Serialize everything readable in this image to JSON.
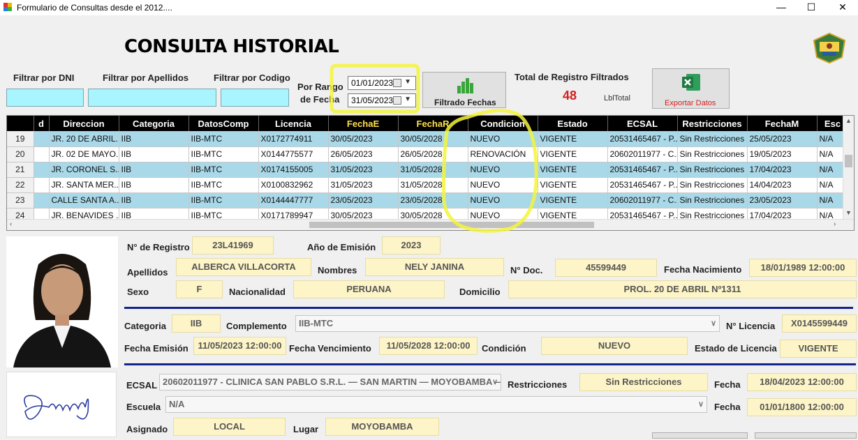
{
  "window": {
    "title": "Formulario de Consultas desde el  2012....",
    "minimize": "—",
    "maximize": "☐",
    "close": "✕"
  },
  "heading": "CONSULTA HISTORIAL",
  "filters": {
    "dni_label": "Filtrar por DNI",
    "apellidos_label": "Filtrar por Apellidos",
    "codigo_label": "Filtrar por Codigo",
    "rango_label_1": "Por Rango",
    "rango_label_2": "de Fecha",
    "date_from": "01/01/2023",
    "date_to": "31/05/2023",
    "filter_button": "Filtrado Fechas"
  },
  "totals": {
    "label": "Total de Registro Filtrados",
    "value": "48",
    "lbl_total": "LblTotal"
  },
  "export_button": "Exportar Datos",
  "grid": {
    "columns": [
      "d",
      "Direccion",
      "Categoria",
      "DatosComp",
      "Licencia",
      "FechaE",
      "FechaR",
      "Condicion",
      "Estado",
      "ECSAL",
      "Restricciones",
      "FechaM",
      "Esc"
    ],
    "rows": [
      {
        "n": "19",
        "cells": [
          "",
          "JR. 20 DE ABRIL...",
          "IIB",
          "IIB-MTC",
          "X0172774911",
          "30/05/2023",
          "30/05/2028",
          "NUEVO",
          "VIGENTE",
          "20531465467 - P...",
          "Sin Restricciones",
          "25/05/2023",
          "N/A"
        ]
      },
      {
        "n": "20",
        "cells": [
          "",
          "JR. 02 DE MAYO...",
          "IIB",
          "IIB-MTC",
          "X0144775577",
          "26/05/2023",
          "26/05/2028",
          "RENOVACIÓN",
          "VIGENTE",
          "20602011977 - C...",
          "Sin Restricciones",
          "19/05/2023",
          "N/A"
        ]
      },
      {
        "n": "21",
        "cells": [
          "",
          "JR. CORONEL S...",
          "IIB",
          "IIB-MTC",
          "X0174155005",
          "31/05/2023",
          "31/05/2028",
          "NUEVO",
          "VIGENTE",
          "20531465467 - P...",
          "Sin Restricciones",
          "17/04/2023",
          "N/A"
        ]
      },
      {
        "n": "22",
        "cells": [
          "",
          "JR. SANTA MER...",
          "IIB",
          "IIB-MTC",
          "X0100832962",
          "31/05/2023",
          "31/05/2028",
          "NUEVO",
          "VIGENTE",
          "20531465467 - P...",
          "Sin Restricciones",
          "14/04/2023",
          "N/A"
        ]
      },
      {
        "n": "23",
        "cells": [
          "",
          "CALLE SANTA A...",
          "IIB",
          "IIB-MTC",
          "X0144447777",
          "23/05/2023",
          "23/05/2028",
          "NUEVO",
          "VIGENTE",
          "20602011977 - C...",
          "Sin Restricciones",
          "23/05/2023",
          "N/A"
        ]
      },
      {
        "n": "24",
        "cells": [
          "",
          "JR. BENAVIDES ...",
          "IIB",
          "IIB-MTC",
          "X0171789947",
          "30/05/2023",
          "30/05/2028",
          "NUEVO",
          "VIGENTE",
          "20531465467 - P...",
          "Sin Restricciones",
          "17/04/2023",
          "N/A"
        ]
      }
    ]
  },
  "detail": {
    "nro_registro_label": "N° de Registro",
    "nro_registro": "23L41969",
    "anio_label": "Año de Emisión",
    "anio": "2023",
    "apellidos_label": "Apellidos",
    "apellidos": "ALBERCA VILLACORTA",
    "nombres_label": "Nombres",
    "nombres": "NELY JANINA",
    "nro_doc_label": "N° Doc.",
    "nro_doc": "45599449",
    "fecha_nac_label": "Fecha Nacimiento",
    "fecha_nac": "18/01/1989 12:00:00",
    "sexo_label": "Sexo",
    "sexo": "F",
    "nacionalidad_label": "Nacionalidad",
    "nacionalidad": "PERUANA",
    "domicilio_label": "Domicilio",
    "domicilio": "PROL. 20 DE ABRIL Nº1311",
    "categoria_label": "Categoria",
    "categoria": "IIB",
    "complemento_label": "Complemento",
    "complemento": "IIB-MTC",
    "nro_licencia_label": "N° Licencia",
    "nro_licencia": "X0145599449",
    "fecha_emision_label": "Fecha Emisión",
    "fecha_emision": "11/05/2023 12:00:00",
    "fecha_venc_label": "Fecha Vencimiento",
    "fecha_venc": "11/05/2028 12:00:00",
    "condicion_label": "Condición",
    "condicion": "NUEVO",
    "estado_label": "Estado de Licencia",
    "estado": "VIGENTE",
    "ecsal_label": "ECSAL",
    "ecsal": "20602011977 - CLINICA SAN PABLO S.R.L. — SAN MARTIN — MOYOBAMBA —",
    "restricciones_label": "Restricciones",
    "restricciones": "Sin Restricciones",
    "fecha1_label": "Fecha",
    "fecha1": "18/04/2023 12:00:00",
    "escuela_label": "Escuela",
    "escuela": "N/A",
    "fecha2_label": "Fecha",
    "fecha2": "01/01/1800 12:00:00",
    "asignado_label": "Asignado",
    "asignado": "LOCAL",
    "lugar_label": "Lugar",
    "lugar": "MOYOBAMBA"
  },
  "colors": {
    "row_alt": "#a9d8e8",
    "field_bg": "#fdf5c7",
    "highlighter": "#f4f43a",
    "total": "#d42020"
  }
}
